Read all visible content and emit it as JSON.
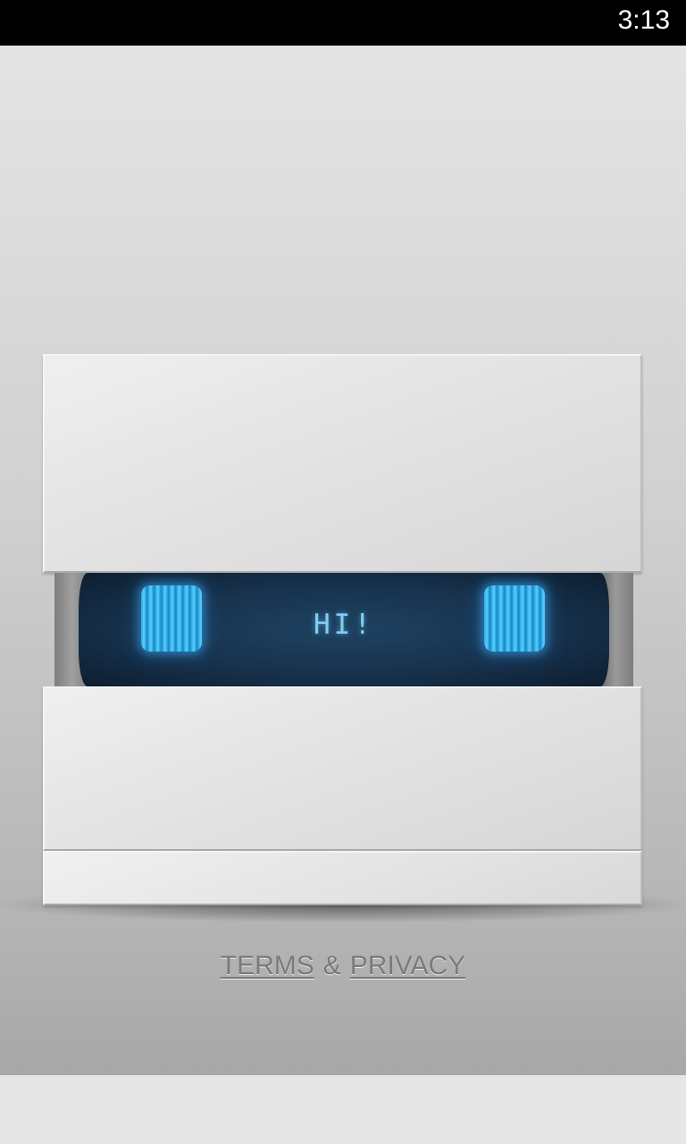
{
  "status_bar": {
    "time": "3:13"
  },
  "robot": {
    "screen_text": "HI!",
    "colors": {
      "screen": "#17324d",
      "eye": "#2aa9e6",
      "text": "#7ed0f4"
    }
  },
  "footer": {
    "terms_label": "TERMS",
    "separator": "&",
    "privacy_label": "PRIVACY"
  }
}
